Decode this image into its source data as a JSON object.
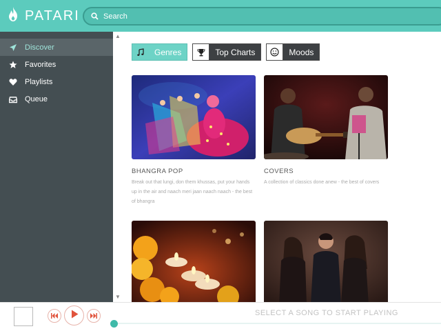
{
  "app": {
    "name": "PATARI",
    "logo_icon": "flame-icon"
  },
  "search": {
    "placeholder": "Search",
    "icon": "search-icon"
  },
  "sidebar": {
    "items": [
      {
        "label": "Discover",
        "icon": "paper-plane-icon",
        "active": true
      },
      {
        "label": "Favorites",
        "icon": "star-icon",
        "active": false
      },
      {
        "label": "Playlists",
        "icon": "heart-icon",
        "active": false
      },
      {
        "label": "Queue",
        "icon": "inbox-icon",
        "active": false
      }
    ]
  },
  "tabs": [
    {
      "label": "Genres",
      "icon": "music-note-icon",
      "active": true
    },
    {
      "label": "Top Charts",
      "icon": "trophy-icon",
      "active": false
    },
    {
      "label": "Moods",
      "icon": "smiley-icon",
      "active": false
    }
  ],
  "cards": [
    {
      "title": "BHANGRA POP",
      "description": "Break out that lungi, don them khussas, put your hands up in the air and naach meri jaan naach naach - the best of bhangra"
    },
    {
      "title": "COVERS",
      "description": "A collection of classics done anew - the best of covers"
    },
    {
      "title": "",
      "description": ""
    },
    {
      "title": "",
      "description": ""
    }
  ],
  "player": {
    "status": "SELECT A SONG TO START PLAYING",
    "controls": [
      "previous-icon",
      "play-icon",
      "next-icon"
    ]
  },
  "colors": {
    "accent": "#5ccbbd",
    "sidebar": "#444e52",
    "control_ring": "#e7b3aa",
    "control_icon": "#e0533c"
  }
}
